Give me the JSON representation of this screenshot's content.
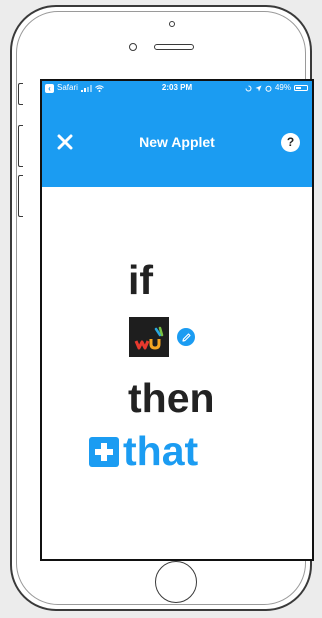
{
  "status_bar": {
    "back_app": "Safari",
    "time": "2:03 PM",
    "battery": "49%",
    "battery_level": 0.49,
    "icons": [
      "back-arrow-icon",
      "signal-icon",
      "wifi-icon",
      "rotation-lock-icon",
      "location-icon",
      "alarm-icon",
      "battery-icon"
    ]
  },
  "header": {
    "title": "New Applet",
    "close_icon": "close-icon",
    "help_label": "?"
  },
  "applet": {
    "if_text": "if",
    "service_logo_text": "wu",
    "service_icon": "weather-underground-logo",
    "edit_icon": "pencil-icon",
    "then_text": "then",
    "that_text": "that",
    "that_icon": "plus-icon"
  },
  "colors": {
    "accent": "#1b9cf2",
    "text": "#222222",
    "background": "#ffffff"
  }
}
